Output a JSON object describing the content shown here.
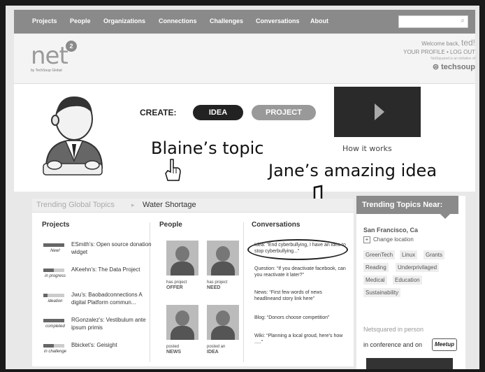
{
  "nav": {
    "items": [
      "Projects",
      "People",
      "Organizations",
      "Connections",
      "Challenges",
      "Conversations",
      "About"
    ],
    "search_icon": "search-icon"
  },
  "header": {
    "logo_text": "net",
    "logo_badge": "2",
    "logo_by": "by TechSoup Global",
    "welcome_prefix": "Welcome back,",
    "username": "ted!",
    "profile_link": "YOUR PROFILE",
    "separator": "•",
    "logout_link": "LOG OUT",
    "initiative": "NetSquared is an initiative of",
    "techsoup": "techsoup"
  },
  "hero": {
    "create_label": "CREATE:",
    "idea_button": "IDEA",
    "project_button": "PROJECT",
    "how_it_works": "How it works"
  },
  "annotations": {
    "blaine": "Blaine’s topic",
    "jane": "Jane’s amazing idea"
  },
  "trending": {
    "label": "Trending Global Topics",
    "arrow": "▸",
    "topic": "Water Shortage"
  },
  "columns": {
    "projects": "Projects",
    "people": "People",
    "conversations": "Conversations"
  },
  "projects": [
    {
      "status": "New!",
      "progress": 1.0,
      "text": "ESmith’s: Open source donation widget"
    },
    {
      "status": "in progress",
      "progress": 0.5,
      "text": "AKeehn’s: The Data Project"
    },
    {
      "status": "ideation",
      "progress": 0.2,
      "text": "Jwu’s: Baobadconnections A digital Platform commun..."
    },
    {
      "status": "completed",
      "progress": 1.0,
      "text": "RGonzalez’s: Vestibulum ante ipsum primis"
    },
    {
      "status": "in challenge",
      "progress": 0.5,
      "text": "Bbicket’s: Geisight"
    }
  ],
  "people": [
    {
      "caption_small": "has project",
      "caption_big": "OFFER"
    },
    {
      "caption_small": "has project",
      "caption_big": "NEED"
    },
    {
      "caption_small": "posted",
      "caption_big": "NEWS"
    },
    {
      "caption_small": "posted an",
      "caption_big": "IDEA"
    }
  ],
  "conversations": [
    "Idea: “End cyberbullying, I have an idea to stop cyberbullying...”",
    "Question: “If you deactivate facebook, can you reactivate it later?”",
    "News: “First few words of news headlineand story link here”",
    "Blog: “Donors choose competition”",
    "Wiki: “Planning a local groud, here’s how .....”"
  ],
  "sidebar": {
    "title": "Trending Topics Near:",
    "location": "San Francisco, Ca",
    "change_location": "Change location",
    "tags": [
      "GreenTech",
      "Linux",
      "Grants",
      "Reading",
      "Underprivilaged",
      "Medical",
      "Education",
      "Sustainability"
    ],
    "netsquared_in_person": "Netsquared in person",
    "conference_text": "in conference and on",
    "meetup": "Meetup"
  }
}
